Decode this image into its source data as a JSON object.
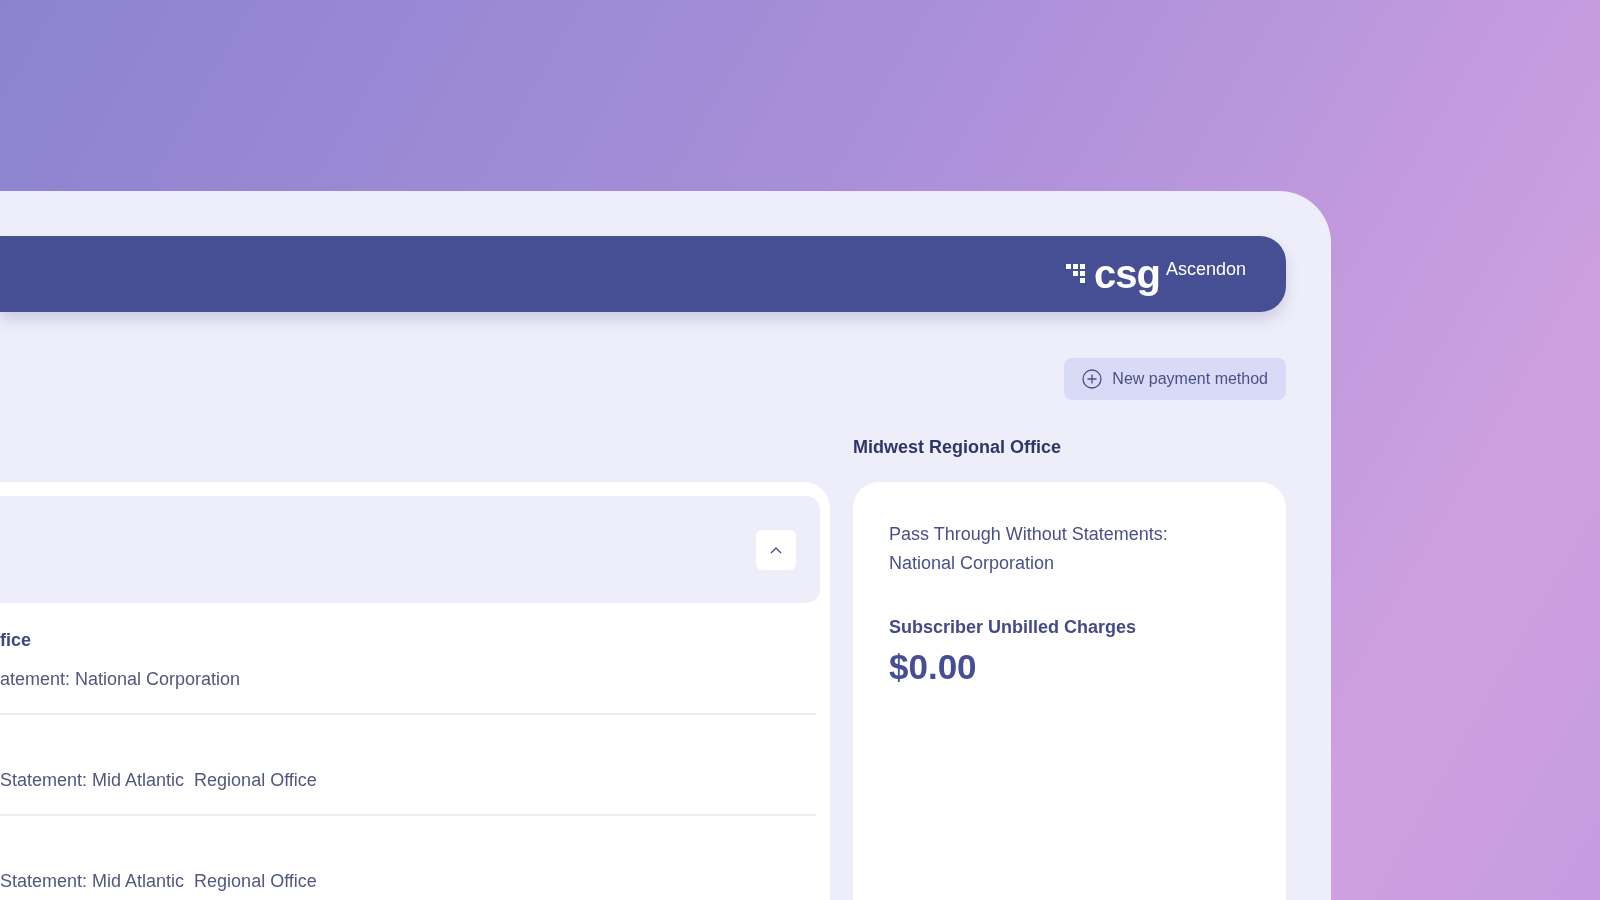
{
  "header": {
    "logo_text": "csg",
    "product": "Ascendon"
  },
  "toolbar": {
    "new_payment_button": {
      "label": "New payment method"
    }
  },
  "accounts_panel": {
    "section": {
      "expanded": true
    },
    "rows": [
      {
        "title": "fice",
        "detail": "atement: National Corporation"
      },
      {
        "detail": "Statement: Mid Atlantic  Regional Office"
      },
      {
        "detail": "Statement: Mid Atlantic  Regional Office"
      }
    ]
  },
  "summary": {
    "heading": "Midwest Regional Office",
    "description": "Pass Through Without Statements: National Corporation",
    "charges_label": "Subscriber Unbilled Charges",
    "charges_value": "$0.00"
  }
}
